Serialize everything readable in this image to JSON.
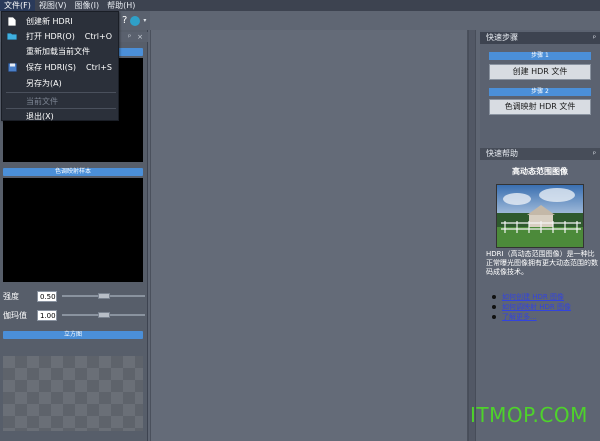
{
  "menubar": {
    "items": [
      {
        "label": "文件(F)"
      },
      {
        "label": "视图(V)"
      },
      {
        "label": "图像(I)"
      },
      {
        "label": "帮助(H)"
      }
    ]
  },
  "file_menu": {
    "items": [
      {
        "label": "创建新 HDRI",
        "shortcut": "",
        "icon": "new-file-icon",
        "enabled": true
      },
      {
        "label": "打开 HDR(O)",
        "shortcut": "Ctrl+O",
        "icon": "open-folder-icon",
        "enabled": true
      },
      {
        "label": "重新加载当前文件",
        "shortcut": "",
        "icon": "",
        "enabled": true
      },
      {
        "label": "保存 HDRI(S)",
        "shortcut": "Ctrl+S",
        "icon": "save-disk-icon",
        "enabled": true
      },
      {
        "label": "另存为(A)",
        "shortcut": "",
        "icon": "",
        "enabled": true
      },
      {
        "label": "当前文件",
        "shortcut": "",
        "icon": "",
        "enabled": false
      },
      {
        "label": "退出(X)",
        "shortcut": "",
        "icon": "",
        "enabled": true
      }
    ]
  },
  "left_panel": {
    "pin": "ᵖ",
    "close": "×",
    "tone_preview_label": "色调映射样本",
    "strength_label": "强度",
    "strength_value": "0.50",
    "strength_level": 0.5,
    "gamma_label": "伽玛值",
    "gamma_value": "1.00",
    "gamma_level": 0.5,
    "cube_label": "立方图"
  },
  "right_panel": {
    "quick_steps_title": "快速步骤",
    "step1_label": "步骤 1",
    "step1_button": "创建 HDR 文件",
    "step2_label": "步骤 2",
    "step2_button": "色调映射 HDR 文件",
    "help_title": "快速帮助",
    "help_heading": "高动态范围图像",
    "help_text": "HDRI（高动态范围图像）是一种比正常曝光图像拥有更大动态范围的数码成像技术。",
    "help_links": [
      "如何创建 HDR 图像",
      "如何调映射 HDR 图像",
      "了解更多..."
    ]
  },
  "watermark": "ITMOP.COM",
  "colors": {
    "accent_blue": "#4b8fd8",
    "menu_bg": "#2b303a",
    "watermark": "#4ed22b"
  }
}
